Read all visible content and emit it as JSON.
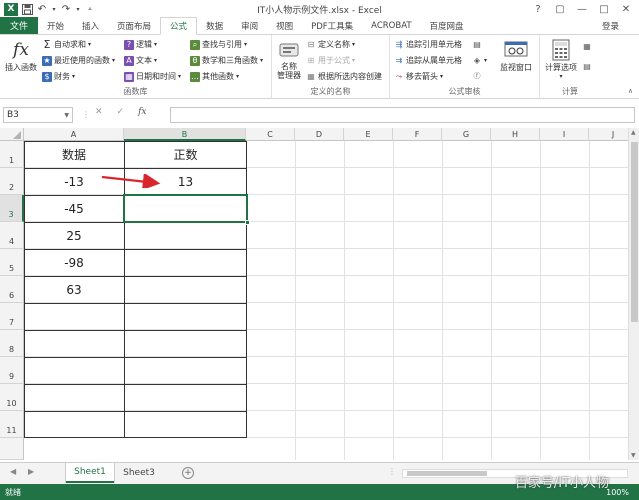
{
  "window": {
    "title": "IT小人物示例文件.xlsx - Excel",
    "controls": [
      "?",
      "▢",
      "—",
      "□",
      "✕"
    ]
  },
  "qat": {
    "icons": [
      "excel-logo",
      "save-icon",
      "undo-icon",
      "redo-icon",
      "customize-icon"
    ]
  },
  "tabs": {
    "file": "文件",
    "items": [
      "开始",
      "插入",
      "页面布局",
      "公式",
      "数据",
      "审阅",
      "视图",
      "PDF工具集",
      "ACROBAT",
      "百度网盘"
    ],
    "active_index": 3,
    "signin": "登录"
  },
  "ribbon": {
    "function_library": {
      "label": "函数库",
      "insert_function": "插入函数",
      "autosum": "自动求和",
      "recent": "最近使用的函数",
      "financial": "财务",
      "logical": "逻辑",
      "text": "文本",
      "datetime": "日期和时间",
      "lookup": "查找与引用",
      "math": "数学和三角函数",
      "other": "其他函数"
    },
    "defined_names": {
      "label": "定义的名称",
      "name_manager": "名称\n管理器",
      "define_name": "定义名称",
      "use_in_formula": "用于公式",
      "create_from_selection": "根据所选内容创建"
    },
    "formula_auditing": {
      "label": "公式审核",
      "trace_precedents": "追踪引用单元格",
      "trace_dependents": "追踪从属单元格",
      "remove_arrows": "移去箭头",
      "watch_window": "监视窗口"
    },
    "calculation": {
      "label": "计算",
      "calc_options": "计算选项"
    }
  },
  "formula_bar": {
    "name_box": "B3",
    "cancel": "✕",
    "enter": "✓",
    "fx": "fx",
    "value": ""
  },
  "grid": {
    "columns": [
      "A",
      "B",
      "C",
      "D",
      "E",
      "F",
      "G",
      "H",
      "I",
      "J"
    ],
    "rows": [
      "1",
      "2",
      "3",
      "4",
      "5",
      "6",
      "7",
      "8",
      "9",
      "10",
      "11"
    ],
    "selected_column": "B",
    "selected_row": "3",
    "headers": {
      "A1": "数据",
      "B1": "正数"
    },
    "column_a": [
      "-13",
      "-45",
      "25",
      "-98",
      "63"
    ],
    "column_b": [
      "13"
    ]
  },
  "sheets": {
    "tabs": [
      "Sheet1",
      "Sheet3"
    ],
    "active_index": 0
  },
  "status": {
    "ready": "就绪",
    "zoom": "100%"
  },
  "watermark": "百家号/IT小人物"
}
